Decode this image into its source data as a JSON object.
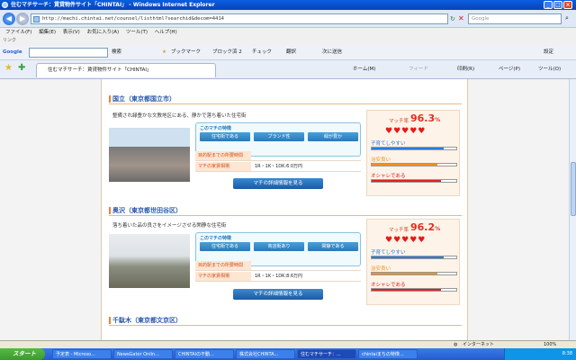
{
  "window": {
    "title": "住むマチサーチ：賃貸物件サイト「CHINTAI」 - Windows Internet Explorer"
  },
  "address": {
    "url": "http://machi.chintai.net/counsel/listhtml?searchid&decom=4414",
    "search_placeholder": "Google"
  },
  "menu": [
    "ファイル(F)",
    "編集(E)",
    "表示(V)",
    "お気に入り(A)",
    "ツール(T)",
    "ヘルプ(H)"
  ],
  "links_label": "リンク",
  "google_bar": {
    "logo": "Google",
    "search_label": "検索",
    "bookmarks": "ブックマーク",
    "popup": "ブロック済 2",
    "check": "チェック",
    "translate": "翻訳",
    "send": "次に送信",
    "settings": "設定"
  },
  "tab": {
    "label": "住むマチサーチ：賃貸物件サイト「CHINTAI」",
    "home": "ホーム(M)",
    "feeds": "フィード",
    "print": "印刷(R)",
    "page": "ページ(P)",
    "tools": "ツール(O)"
  },
  "common": {
    "feature_title": "このマチの特徴",
    "row1": "目的駅までの所要時間",
    "row2": "マチの家賃相場",
    "detail": "マチの詳細情報を見る",
    "match_label": "マッチ率",
    "b1": "子育てしやすい",
    "b2": "治安良い",
    "b3": "オシャレである",
    "hearts": "♥♥♥♥♥"
  },
  "areas": [
    {
      "name": "国立（東京都国立市）",
      "desc": "整備され緑豊かな文教地区にある、静かで落ち着いた住宅街",
      "features": [
        "住宅街である",
        "ブランド性",
        "緑が豊か"
      ],
      "rent": "1R・1K・1DK:6.0万円",
      "match": "96.3",
      "unit": "%",
      "bars": [
        0.85,
        0.78,
        0.82
      ]
    },
    {
      "name": "奥沢（東京都世田谷区）",
      "desc": "落ち着いた品の良さをイメージさせる閑静な住宅街",
      "features": [
        "住宅街である",
        "商店街あり",
        "閑静である"
      ],
      "rent": "1R・1K・1DK:8.6万円",
      "match": "96.2",
      "unit": "%",
      "bars": [
        0.85,
        0.78,
        0.82
      ]
    }
  ],
  "area3": {
    "name": "千駄木（東京都文京区）"
  },
  "status": {
    "zone": "インターネット",
    "zoom": "100%"
  },
  "taskbar": {
    "start": "スタート",
    "tasks": [
      "予定表 - Microso...",
      "NewsGator Onlin...",
      "CHINTAIの不動...",
      "株式会社CHINTA...",
      "住むマチサーチ：...",
      "chintaiまちの特徴..."
    ],
    "clock": "8:38"
  },
  "colors": {
    "accent": "#2a5aa8",
    "match": "#e03020",
    "bar1": "#2a7ae0",
    "bar2": "#f09020",
    "bar3": "#e02020"
  }
}
